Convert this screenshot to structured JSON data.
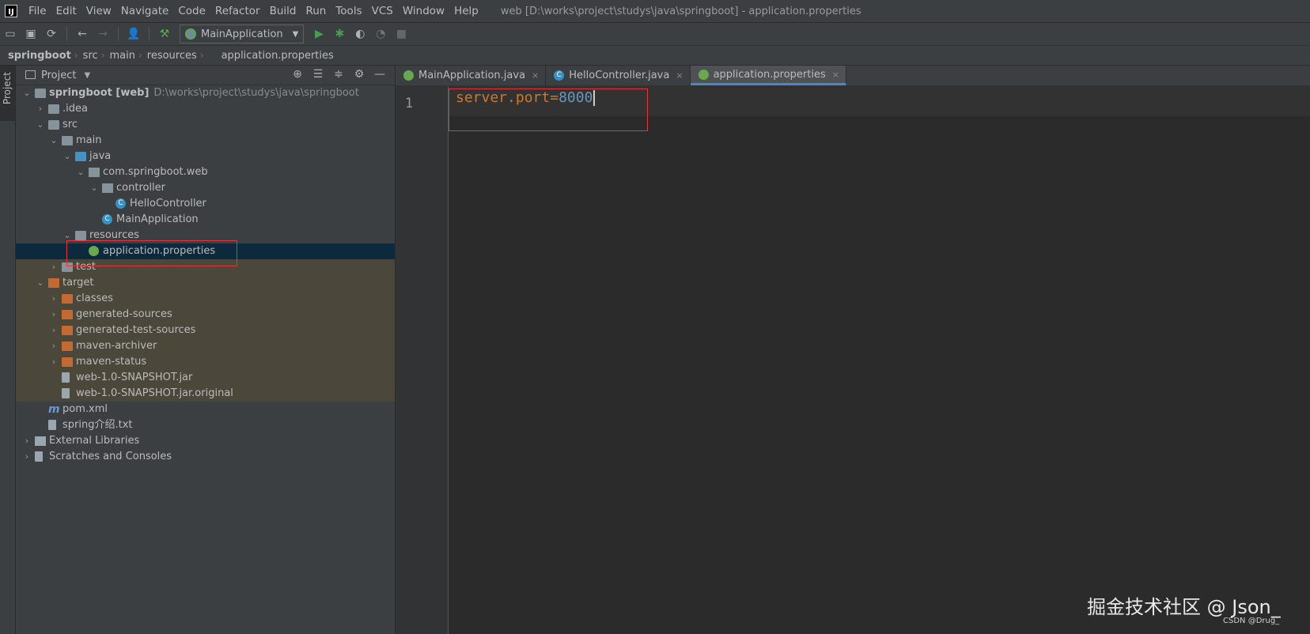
{
  "menubar": {
    "items": [
      "File",
      "Edit",
      "View",
      "Navigate",
      "Code",
      "Refactor",
      "Build",
      "Run",
      "Tools",
      "VCS",
      "Window",
      "Help"
    ],
    "window_title": "web [D:\\works\\project\\studys\\java\\springboot] - application.properties"
  },
  "toolbar": {
    "run_config": "MainApplication",
    "icons": [
      "open-folder-icon",
      "save-icon",
      "sync-icon",
      "back-icon",
      "forward-icon",
      "user-icon",
      "build-hammer-icon",
      "run-icon",
      "debug-icon",
      "coverage-icon",
      "profile-icon",
      "stop-icon"
    ]
  },
  "breadcrumb": [
    "springboot",
    "src",
    "main",
    "resources",
    "application.properties"
  ],
  "side_strip": {
    "label": "Project"
  },
  "project_panel": {
    "title": "Project",
    "tree": [
      {
        "label": "springboot [web]",
        "hint": "D:\\works\\project\\studys\\java\\springboot",
        "depth": 0,
        "arrow": "down",
        "icon": "folder"
      },
      {
        "label": ".idea",
        "depth": 1,
        "arrow": "right",
        "icon": "folder"
      },
      {
        "label": "src",
        "depth": 1,
        "arrow": "down",
        "icon": "folder"
      },
      {
        "label": "main",
        "depth": 2,
        "arrow": "down",
        "icon": "folder"
      },
      {
        "label": "java",
        "depth": 3,
        "arrow": "down",
        "icon": "folder-blue"
      },
      {
        "label": "com.springboot.web",
        "depth": 4,
        "arrow": "down",
        "icon": "package"
      },
      {
        "label": "controller",
        "depth": 5,
        "arrow": "down",
        "icon": "package"
      },
      {
        "label": "HelloController",
        "depth": 6,
        "arrow": "",
        "icon": "class"
      },
      {
        "label": "MainApplication",
        "depth": 5,
        "arrow": "",
        "icon": "class"
      },
      {
        "label": "resources",
        "depth": 3,
        "arrow": "down",
        "icon": "folder"
      },
      {
        "label": "application.properties",
        "depth": 4,
        "arrow": "",
        "icon": "leaf",
        "selected": true
      },
      {
        "label": "test",
        "depth": 2,
        "arrow": "right",
        "icon": "folder",
        "excluded": true
      },
      {
        "label": "target",
        "depth": 1,
        "arrow": "down",
        "icon": "folder-orange",
        "excluded": true
      },
      {
        "label": "classes",
        "depth": 2,
        "arrow": "right",
        "icon": "folder-orange",
        "excluded": true
      },
      {
        "label": "generated-sources",
        "depth": 2,
        "arrow": "right",
        "icon": "folder-orange",
        "excluded": true
      },
      {
        "label": "generated-test-sources",
        "depth": 2,
        "arrow": "right",
        "icon": "folder-orange",
        "excluded": true
      },
      {
        "label": "maven-archiver",
        "depth": 2,
        "arrow": "right",
        "icon": "folder-orange",
        "excluded": true
      },
      {
        "label": "maven-status",
        "depth": 2,
        "arrow": "right",
        "icon": "folder-orange",
        "excluded": true
      },
      {
        "label": "web-1.0-SNAPSHOT.jar",
        "depth": 2,
        "arrow": "",
        "icon": "jar",
        "excluded": true
      },
      {
        "label": "web-1.0-SNAPSHOT.jar.original",
        "depth": 2,
        "arrow": "",
        "icon": "file",
        "excluded": true
      },
      {
        "label": "pom.xml",
        "depth": 1,
        "arrow": "",
        "icon": "pom"
      },
      {
        "label": "spring介绍.txt",
        "depth": 1,
        "arrow": "",
        "icon": "file"
      },
      {
        "label": "External Libraries",
        "depth": 0,
        "arrow": "right",
        "icon": "lib"
      },
      {
        "label": "Scratches and Consoles",
        "depth": 0,
        "arrow": "right",
        "icon": "scratch"
      }
    ]
  },
  "editor": {
    "tabs": [
      {
        "label": "MainApplication.java",
        "icon": "leaf",
        "active": false
      },
      {
        "label": "HelloController.java",
        "icon": "c",
        "active": false
      },
      {
        "label": "application.properties",
        "icon": "leaf",
        "active": true
      }
    ],
    "line_number": "1",
    "code_key": "server.port",
    "code_eq": "=",
    "code_value": "8000"
  },
  "watermark": {
    "main": "掘金技术社区 @ Json_",
    "small": "CSDN @Drug_"
  },
  "colors": {
    "accent": "#4a88c7",
    "highlight_box": "#e0383e",
    "selected_row": "#0d293e",
    "excluded_bg": "#4b473a"
  }
}
